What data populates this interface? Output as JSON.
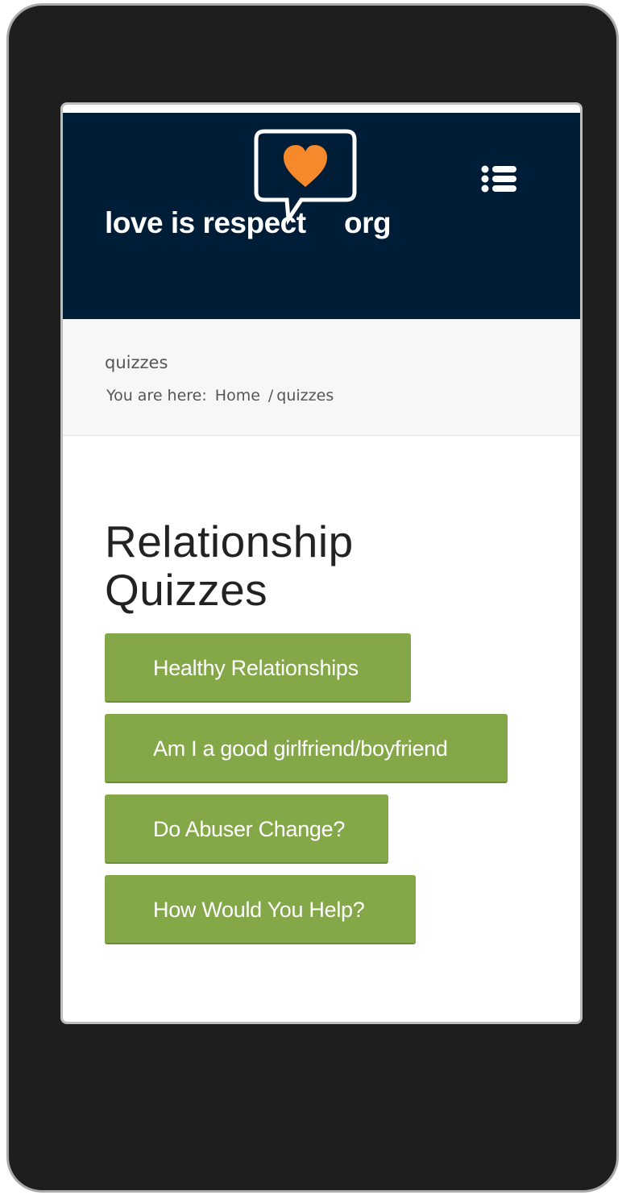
{
  "header": {
    "logo_text": "love is respect",
    "logo_suffix": "org",
    "logo_heart_color": "#f6892b",
    "background_color": "#001d38",
    "menu_icon": "list-icon"
  },
  "page": {
    "title": "quizzes",
    "breadcrumb": {
      "prefix": "You are here:",
      "home": "Home",
      "separator": "/",
      "current": "quizzes"
    }
  },
  "main": {
    "heading": "Relationship Quizzes",
    "button_color": "#84a847",
    "quizzes": [
      {
        "label": "Healthy Relationships"
      },
      {
        "label": "Am I a good girlfriend/boyfriend"
      },
      {
        "label": "Do Abuser Change?"
      },
      {
        "label": "How Would You Help?"
      }
    ]
  }
}
